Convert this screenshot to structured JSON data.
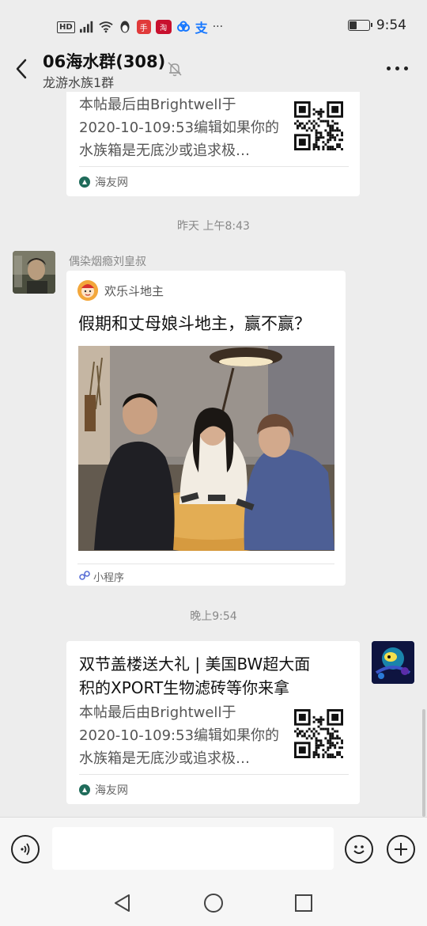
{
  "status_bar": {
    "network_label": "HD",
    "signal_label": "46",
    "red_app_label": "手",
    "red_app2_label": "淘",
    "blue_app_label": "支",
    "more_label": "···",
    "battery_level": 0.4,
    "time": "9:54"
  },
  "header": {
    "title": "06海水群(308)",
    "subtitle": "龙游水族1群"
  },
  "messages": {
    "top_card": {
      "excerpt_lines": [
        "本帖最后由Brightwell于",
        "2020-10-109:53编辑如果你的",
        "水族箱是无底沙或追求极…"
      ],
      "source": "海友网"
    },
    "time1": "昨天 上午8:43",
    "mini_program": {
      "sender": "偶染烟瘾刘皇叔",
      "app_name": "欢乐斗地主",
      "title": "假期和丈母娘斗地主，赢不赢？",
      "footer_label": "小程序"
    },
    "time2": "晚上9:54",
    "bottom_card": {
      "title_lines": [
        "双节盖楼送大礼 | 美国BW超大面",
        "积的XPORT生物滤砖等你来拿"
      ],
      "excerpt_lines": [
        "本帖最后由Brightwell于",
        "2020-10-109:53编辑如果你的",
        "水族箱是无底沙或追求极…"
      ],
      "source": "海友网"
    }
  },
  "input": {
    "value": "",
    "placeholder": ""
  },
  "icons": [
    "back-arrow-icon",
    "mute-bell-icon",
    "more-dots-icon",
    "voice-icon",
    "emoji-icon",
    "add-icon",
    "nav-back-icon",
    "nav-home-icon",
    "nav-recent-icon"
  ]
}
